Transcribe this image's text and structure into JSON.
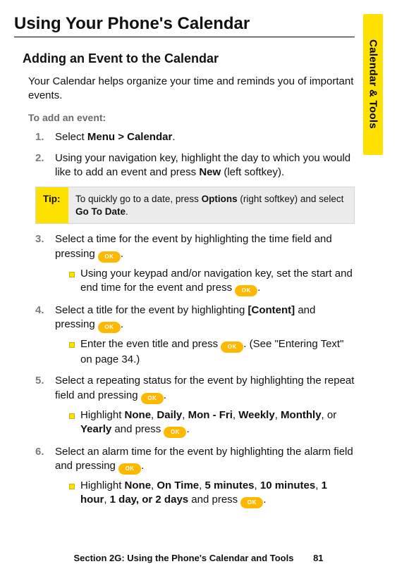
{
  "side_tab": "Calendar & Tools",
  "title": "Using Your Phone's Calendar",
  "section": "Adding an Event to the Calendar",
  "intro": "Your Calendar helps organize your time and reminds you of important events.",
  "lead": "To add an event:",
  "ok_label": "OK",
  "steps": {
    "s1_a": "Select ",
    "s1_b": "Menu > Calendar",
    "s1_c": ".",
    "s2_a": "Using your navigation key, highlight the day to which you would like to add an event and press ",
    "s2_b": "New",
    "s2_c": " (left softkey).",
    "s3_a": "Select a time for the event by highlighting the time field and pressing ",
    "s3_c": ".",
    "s3_sub_a": "Using your keypad and/or navigation key, set the start and end time for the event and press ",
    "s3_sub_c": ".",
    "s4_a": "Select a title for the event by highlighting ",
    "s4_b": "[Content]",
    "s4_c": " and pressing ",
    "s4_e": ".",
    "s4_sub_a": "Enter the even title and press ",
    "s4_sub_c": ". (See \"Entering Text\" on page 34.)",
    "s5_a": "Select a repeating status for the event by highlighting the repeat field and pressing ",
    "s5_c": ".",
    "s5_sub_a": "Highlight ",
    "s5_none": "None",
    "s5_daily": "Daily",
    "s5_monfri": "Mon - Fri",
    "s5_weekly": "Weekly",
    "s5_monthly": "Monthly",
    "s5_or": ", or ",
    "s5_yearly": "Yearly",
    "s5_and": " and press ",
    "s5_end": ".",
    "s6_a": "Select an alarm time for the event by highlighting the alarm field and pressing ",
    "s6_c": ".",
    "s6_sub_a": "Highlight ",
    "s6_none": "None",
    "s6_ontime": "On Time",
    "s6_5m": "5 minutes",
    "s6_10m": "10 minutes",
    "s6_1h": "1 hour",
    "s6_1d": "1 day",
    "s6_or2d": ", or 2 days",
    "s6_and": " and press ",
    "s6_end": "."
  },
  "comma": ", ",
  "tip": {
    "label": "Tip:",
    "body_a": "To quickly go to a date, press ",
    "body_b": "Options",
    "body_c": " (right softkey) and select ",
    "body_d": "Go To Date",
    "body_e": "."
  },
  "footer": {
    "text": "Section 2G: Using the Phone's Calendar and Tools",
    "page": "81"
  }
}
